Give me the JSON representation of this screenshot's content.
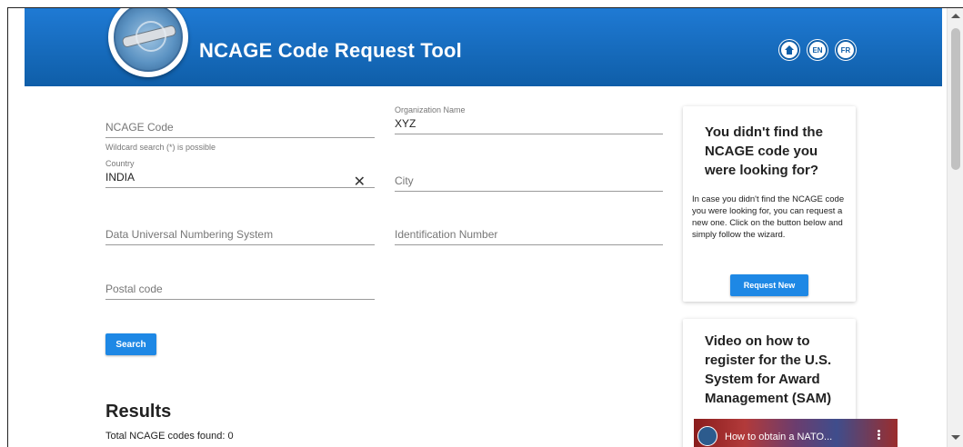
{
  "header": {
    "title": "NCAGE Code Request Tool",
    "lang_en": "EN",
    "lang_fr": "FR"
  },
  "form": {
    "ncage_code": {
      "placeholder": "NCAGE Code",
      "hint": "Wildcard search (*) is possible"
    },
    "organization_name": {
      "label": "Organization Name",
      "value": "XYZ"
    },
    "country": {
      "label": "Country",
      "value": "INDIA",
      "clear": "✕"
    },
    "city": {
      "placeholder": "City"
    },
    "duns": {
      "placeholder": "Data Universal Numbering System"
    },
    "identification_number": {
      "placeholder": "Identification Number"
    },
    "postal_code": {
      "placeholder": "Postal code"
    },
    "search_label": "Search"
  },
  "results": {
    "title": "Results",
    "count_text": "Total NCAGE codes found: 0"
  },
  "sidebar": {
    "request_card": {
      "title": "You didn't find the NCAGE code you were looking for?",
      "text": "In case you didn't find the NCAGE code you were looking for, you can request a new one. Click on the button below and simply follow the wizard.",
      "button_label": "Request New"
    },
    "video_card": {
      "title": "Video on how to register for the U.S. System for Award Management (SAM)",
      "video_title": "How to obtain a NATO..."
    }
  },
  "colors": {
    "header_blue": "#1f7ad4",
    "button_blue": "#1e88e5"
  },
  "icons": {
    "home": "home-icon",
    "clear": "close-icon",
    "menu": "more-vert-icon"
  }
}
